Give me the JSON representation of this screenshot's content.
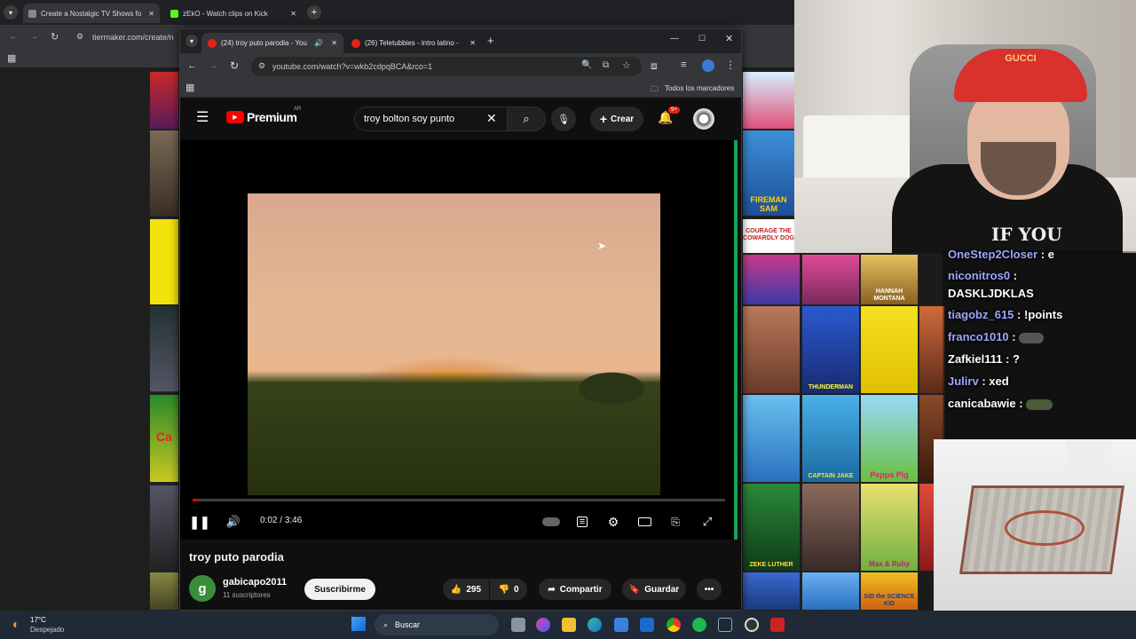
{
  "background_browser": {
    "tabs": [
      {
        "title": "Create a Nostalgic TV Shows fo"
      },
      {
        "title": "zEkO - Watch clips on Kick"
      }
    ],
    "url": "tiermaker.com/create/n"
  },
  "posters_left": [
    {
      "label": ""
    },
    {
      "label": ""
    },
    {
      "label": "Ca"
    },
    {
      "label": ""
    },
    {
      "label": ""
    }
  ],
  "posters_right": [
    {
      "label": ""
    },
    {
      "label": "FIREMAN SAM"
    },
    {
      "label": "COURAGE THE COWARDLY DOG"
    },
    {
      "label": ""
    },
    {
      "label": "HANNAH MONTANA"
    },
    {
      "label": ""
    },
    {
      "label": "THUNDERMAN"
    },
    {
      "label": ""
    },
    {
      "label": ""
    },
    {
      "label": ""
    },
    {
      "label": "CAPTAIN JAKE"
    },
    {
      "label": "Peppa Pig"
    },
    {
      "label": "ZEKE LUTHER"
    },
    {
      "label": ""
    },
    {
      "label": "Max & Ruby"
    },
    {
      "label": ""
    },
    {
      "label": "SID the SCIENCE KID"
    }
  ],
  "front_browser": {
    "tabs": [
      {
        "title": "(24) troy puto parodia - You"
      },
      {
        "title": "(26) Teletubbies - intro latino -"
      }
    ],
    "url": "youtube.com/watch?v=wkb2cdpqBCA&rco=1",
    "bookmarks_label": "Todos los marcadores"
  },
  "youtube": {
    "logo_text": "Premium",
    "country": "AR",
    "search_value": "troy bolton soy punto",
    "create_label": "Crear",
    "notif_badge": "9+",
    "player": {
      "current_time": "0:02",
      "duration": "3:46",
      "progress_fraction": 0.01
    },
    "video_title": "troy puto parodia",
    "channel": {
      "avatar_letter": "g",
      "name": "gabicapo2011",
      "subs": "11 suscriptores",
      "subscribe_label": "Suscribirme"
    },
    "actions": {
      "likes": "295",
      "dislikes": "0",
      "share": "Compartir",
      "save": "Guardar"
    }
  },
  "webcam": {
    "shirt_text": "IF YOU"
  },
  "chat": [
    {
      "user": "OneStep2Closer",
      "msg": ": e"
    },
    {
      "user": "niconitros0",
      "msg": ":"
    },
    {
      "user": "",
      "msg": "DASKLJDKLAS"
    },
    {
      "user": "tiagobz_615",
      "msg": ": !points"
    },
    {
      "user": "franco1010",
      "msg": ":"
    },
    {
      "user": "Zafkiel111",
      "msg": ": ?"
    },
    {
      "user": "Julirv",
      "msg": ": xed"
    },
    {
      "user": "canicabawie",
      "msg": ":"
    }
  ],
  "taskbar": {
    "weather_temp": "17°C",
    "weather_desc": "Despejado",
    "search_label": "Buscar"
  },
  "colors": {
    "youtube_red": "#ff0000",
    "chat_user": "#9da6ff",
    "chrome_dark": "#202124"
  }
}
